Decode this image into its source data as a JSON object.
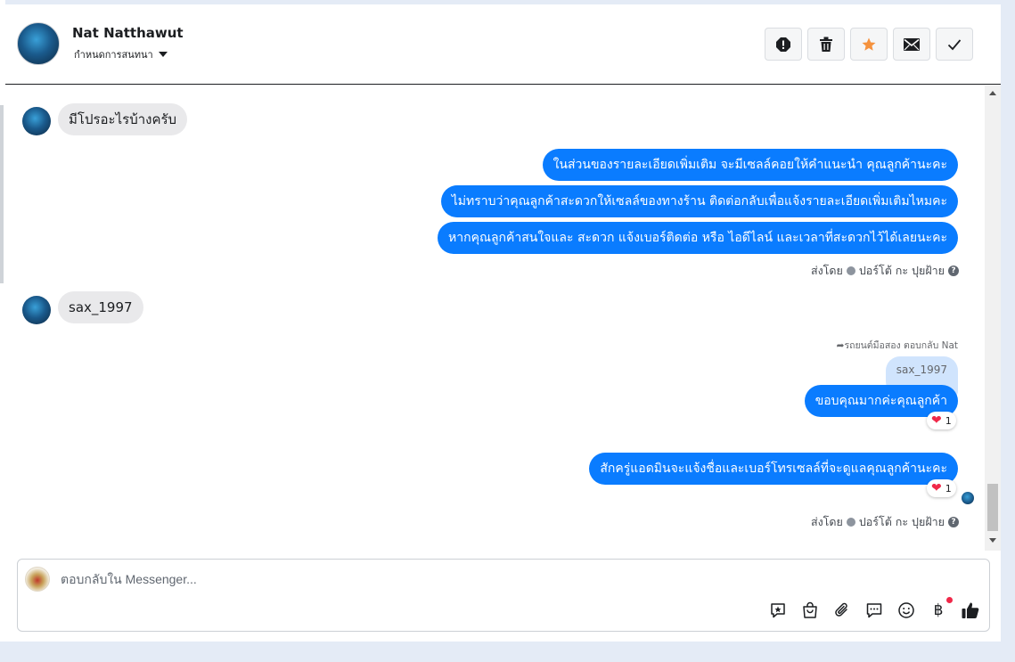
{
  "header": {
    "name": "Nat Natthawut",
    "subtitle": "กำหนดการสนทนา"
  },
  "messages": {
    "incoming_1": "มีโปรอะไรบ้างครับ",
    "outgoing_1": "ในส่วนของรายละเอียดเพิ่มเติม จะมีเซลล์คอยให้คำแนะนำ คุณลูกค้านะคะ",
    "outgoing_2": "ไม่ทราบว่าคุณลูกค้าสะดวกให้เซลล์ของทางร้าน ติดต่อกลับเพื่อแจ้งรายละเอียดเพิ่มเติมไหมคะ",
    "outgoing_3": "หากคุณลูกค้าสนใจและ สะดวก แจ้งเบอร์ติดต่อ หรือ ไอดีไลน์ และเวลาที่สะดวกไว้ได้เลยนะคะ",
    "sent_by_1": "ส่งโดย",
    "sent_by_name_1": "ปอร์โต้ กะ ปุยฝ้าย",
    "incoming_2": "sax_1997",
    "reply_note": "รถยนต์มือสอง ตอบกลับ Nat",
    "quoted_text": "sax_1997",
    "outgoing_4": "ขอบคุณมากค่ะคุณลูกค้า",
    "reaction_4_count": "1",
    "outgoing_5": "สักครู่แอดมินจะแจ้งชื่อและเบอร์โทรเซลล์ที่จะดูแลคุณลูกค้านะคะ",
    "reaction_5_count": "1",
    "sent_by_2": "ส่งโดย",
    "sent_by_name_2": "ปอร์โต้ กะ ปุยฝ้าย"
  },
  "composer": {
    "placeholder": "ตอบกลับใน Messenger..."
  },
  "icons": {
    "actions": [
      "spam-icon",
      "trash-icon",
      "star-icon",
      "mail-icon",
      "check-icon"
    ],
    "tools": [
      "sticker-chat-icon",
      "shopping-bag-icon",
      "paperclip-icon",
      "saved-reply-icon",
      "emoji-icon",
      "baht-icon",
      "thumbs-up-icon"
    ]
  },
  "colors": {
    "accent": "#0a7cff",
    "star": "#f5923e",
    "notification": "#f02849"
  }
}
